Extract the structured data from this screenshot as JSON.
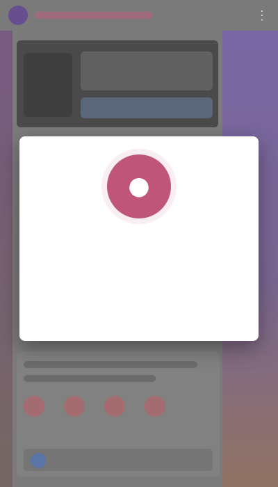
{
  "app": {
    "title": ""
  },
  "topbar": {
    "menu_icon": "more-vert-icon"
  },
  "modal": {
    "icon": "circle-alert-icon",
    "title": "",
    "body": "",
    "primary_action_label": ""
  },
  "colors": {
    "accent": "#c0557a",
    "modal_background": "#ffffff",
    "overlay": "rgba(255,255,255,0.08)"
  }
}
